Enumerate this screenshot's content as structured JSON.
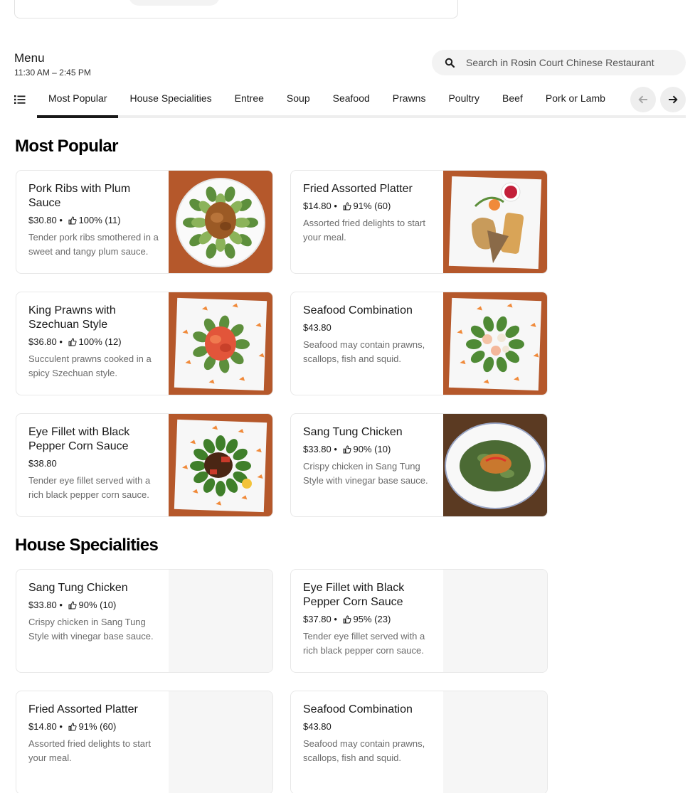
{
  "menu": {
    "title": "Menu",
    "hours": "11:30 AM – 2:45 PM"
  },
  "search": {
    "placeholder": "Search in Rosin Court Chinese Restaurant"
  },
  "tabs": [
    {
      "label": "Most Popular",
      "active": true
    },
    {
      "label": "House Specialities"
    },
    {
      "label": "Entree"
    },
    {
      "label": "Soup"
    },
    {
      "label": "Seafood"
    },
    {
      "label": "Prawns"
    },
    {
      "label": "Poultry"
    },
    {
      "label": "Beef"
    },
    {
      "label": "Pork or Lamb"
    }
  ],
  "sections": [
    {
      "title": "Most Popular",
      "items": [
        {
          "name": "Pork Ribs with Plum Sauce",
          "price": "$30.80",
          "rating": "100% (11)",
          "desc": "Tender pork ribs smothered in a sweet and tangy plum sauce.",
          "image": "pork-ribs-dish"
        },
        {
          "name": "Fried Assorted Platter",
          "price": "$14.80",
          "rating": "91% (60)",
          "desc": "Assorted fried delights to start your meal.",
          "image": "fried-platter-dish"
        },
        {
          "name": "King Prawns with Szechuan Style",
          "price": "$36.80",
          "rating": "100% (12)",
          "desc": "Succulent prawns cooked in a spicy Szechuan style.",
          "image": "szechuan-prawns-dish"
        },
        {
          "name": "Seafood Combination",
          "price": "$43.80",
          "rating": "",
          "desc": "Seafood may contain prawns, scallops, fish and squid.",
          "image": "seafood-combination-dish"
        },
        {
          "name": "Eye Fillet with Black Pepper Corn Sauce",
          "price": "$38.80",
          "rating": "",
          "desc": "Tender eye fillet served with a rich black pepper corn sauce.",
          "image": "eye-fillet-dish"
        },
        {
          "name": "Sang Tung Chicken",
          "price": "$33.80",
          "rating": "90% (10)",
          "desc": "Crispy chicken in Sang Tung Style with vinegar base sauce.",
          "image": "sang-tung-chicken-dish"
        }
      ]
    },
    {
      "title": "House Specialities",
      "items": [
        {
          "name": "Sang Tung Chicken",
          "price": "$33.80",
          "rating": "90% (10)",
          "desc": "Crispy chicken in Sang Tung Style with vinegar base sauce.",
          "image": ""
        },
        {
          "name": "Eye Fillet with Black Pepper Corn Sauce",
          "price": "$37.80",
          "rating": "95% (23)",
          "desc": "Tender eye fillet served with a rich black pepper corn sauce.",
          "image": ""
        },
        {
          "name": "Fried Assorted Platter",
          "price": "$14.80",
          "rating": "91% (60)",
          "desc": "Assorted fried delights to start your meal.",
          "image": ""
        },
        {
          "name": "Seafood Combination",
          "price": "$43.80",
          "rating": "",
          "desc": "Seafood may contain prawns, scallops, fish and squid.",
          "image": ""
        }
      ]
    }
  ],
  "meta_separator": " • ",
  "colors": {
    "text": "#191919",
    "muted": "#6b6b6b",
    "chip": "#f3f3f3",
    "card_border": "#e8e8e8",
    "tab_active": "#191919"
  }
}
